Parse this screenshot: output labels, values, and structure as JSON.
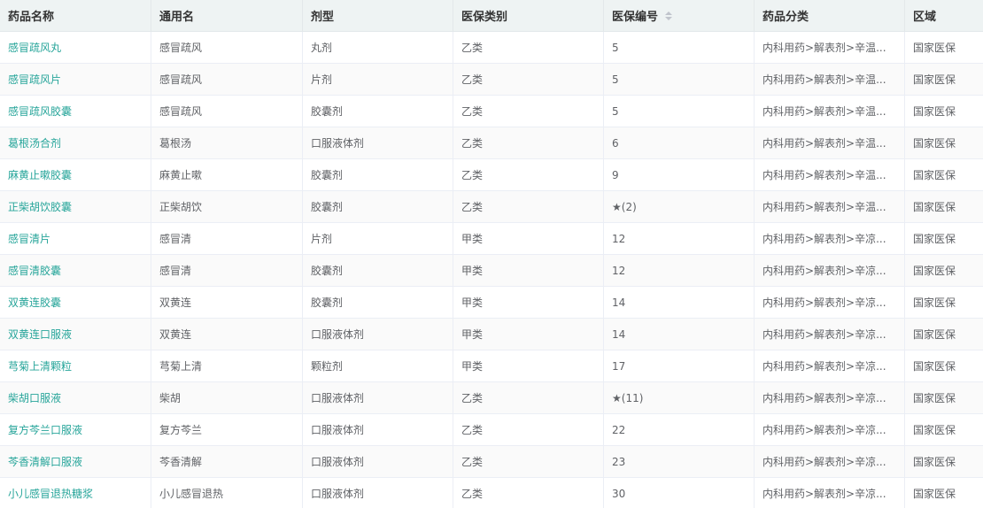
{
  "columns": [
    "药品名称",
    "通用名",
    "剂型",
    "医保类别",
    "医保编号",
    "药品分类",
    "区域"
  ],
  "rows": [
    {
      "name": "感冒疏风丸",
      "generic": "感冒疏风",
      "form": "丸剂",
      "category": "乙类",
      "code": "5",
      "classification": "内科用药>解表剂>辛温...",
      "region": "国家医保"
    },
    {
      "name": "感冒疏风片",
      "generic": "感冒疏风",
      "form": "片剂",
      "category": "乙类",
      "code": "5",
      "classification": "内科用药>解表剂>辛温...",
      "region": "国家医保"
    },
    {
      "name": "感冒疏风胶囊",
      "generic": "感冒疏风",
      "form": "胶囊剂",
      "category": "乙类",
      "code": "5",
      "classification": "内科用药>解表剂>辛温...",
      "region": "国家医保"
    },
    {
      "name": "葛根汤合剂",
      "generic": "葛根汤",
      "form": "口服液体剂",
      "category": "乙类",
      "code": "6",
      "classification": "内科用药>解表剂>辛温...",
      "region": "国家医保"
    },
    {
      "name": "麻黄止嗽胶囊",
      "generic": "麻黄止嗽",
      "form": "胶囊剂",
      "category": "乙类",
      "code": "9",
      "classification": "内科用药>解表剂>辛温...",
      "region": "国家医保"
    },
    {
      "name": "正柴胡饮胶囊",
      "generic": "正柴胡饮",
      "form": "胶囊剂",
      "category": "乙类",
      "code": "★(2)",
      "classification": "内科用药>解表剂>辛温...",
      "region": "国家医保"
    },
    {
      "name": "感冒清片",
      "generic": "感冒清",
      "form": "片剂",
      "category": "甲类",
      "code": "12",
      "classification": "内科用药>解表剂>辛凉...",
      "region": "国家医保"
    },
    {
      "name": "感冒清胶囊",
      "generic": "感冒清",
      "form": "胶囊剂",
      "category": "甲类",
      "code": "12",
      "classification": "内科用药>解表剂>辛凉...",
      "region": "国家医保"
    },
    {
      "name": "双黄连胶囊",
      "generic": "双黄连",
      "form": "胶囊剂",
      "category": "甲类",
      "code": "14",
      "classification": "内科用药>解表剂>辛凉...",
      "region": "国家医保"
    },
    {
      "name": "双黄连口服液",
      "generic": "双黄连",
      "form": "口服液体剂",
      "category": "甲类",
      "code": "14",
      "classification": "内科用药>解表剂>辛凉...",
      "region": "国家医保"
    },
    {
      "name": "芎菊上清颗粒",
      "generic": "芎菊上清",
      "form": "颗粒剂",
      "category": "甲类",
      "code": "17",
      "classification": "内科用药>解表剂>辛凉...",
      "region": "国家医保"
    },
    {
      "name": "柴胡口服液",
      "generic": "柴胡",
      "form": "口服液体剂",
      "category": "乙类",
      "code": "★(11)",
      "classification": "内科用药>解表剂>辛凉...",
      "region": "国家医保"
    },
    {
      "name": "复方芩兰口服液",
      "generic": "复方芩兰",
      "form": "口服液体剂",
      "category": "乙类",
      "code": "22",
      "classification": "内科用药>解表剂>辛凉...",
      "region": "国家医保"
    },
    {
      "name": "芩香清解口服液",
      "generic": "芩香清解",
      "form": "口服液体剂",
      "category": "乙类",
      "code": "23",
      "classification": "内科用药>解表剂>辛凉...",
      "region": "国家医保"
    },
    {
      "name": "小儿感冒退热糖浆",
      "generic": "小儿感冒退热",
      "form": "口服液体剂",
      "category": "乙类",
      "code": "30",
      "classification": "内科用药>解表剂>辛凉...",
      "region": "国家医保"
    }
  ],
  "colors": {
    "link": "#27a59a",
    "header_bg": "#eef3f3",
    "stripe_bg": "#fafafa",
    "border": "#ebeef5"
  },
  "icons": {
    "sort": "sort-icon"
  }
}
